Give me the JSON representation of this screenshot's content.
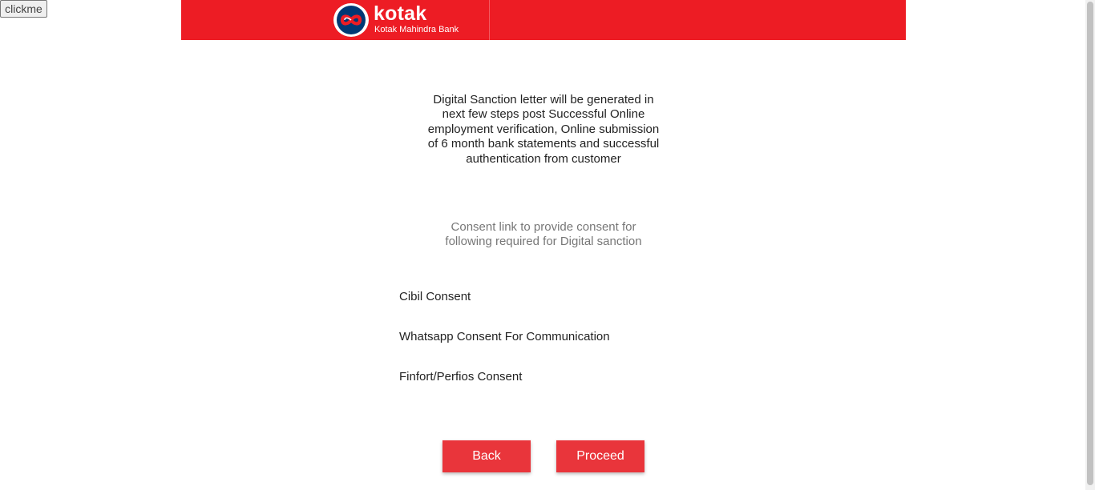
{
  "debug": {
    "clickme_label": "clickme"
  },
  "header": {
    "brand_name": "kotak",
    "brand_subtitle": "Kotak Mahindra Bank",
    "brand_color": "#ed1c24",
    "logo_icon": "kotak-infinity-logo"
  },
  "main": {
    "intro_text": "Digital Sanction letter will be generated in next few steps post Successful Online employment verification, Online submission of 6 month bank statements and successful authentication from customer",
    "consent_link_text": "Consent link to provide consent for following required for Digital sanction",
    "consents": [
      {
        "label": "Cibil Consent"
      },
      {
        "label": "Whatsapp Consent For Communication"
      },
      {
        "label": "Finfort/Perfios Consent"
      }
    ]
  },
  "actions": {
    "back_label": "Back",
    "proceed_label": "Proceed",
    "button_color": "#e9353b"
  }
}
